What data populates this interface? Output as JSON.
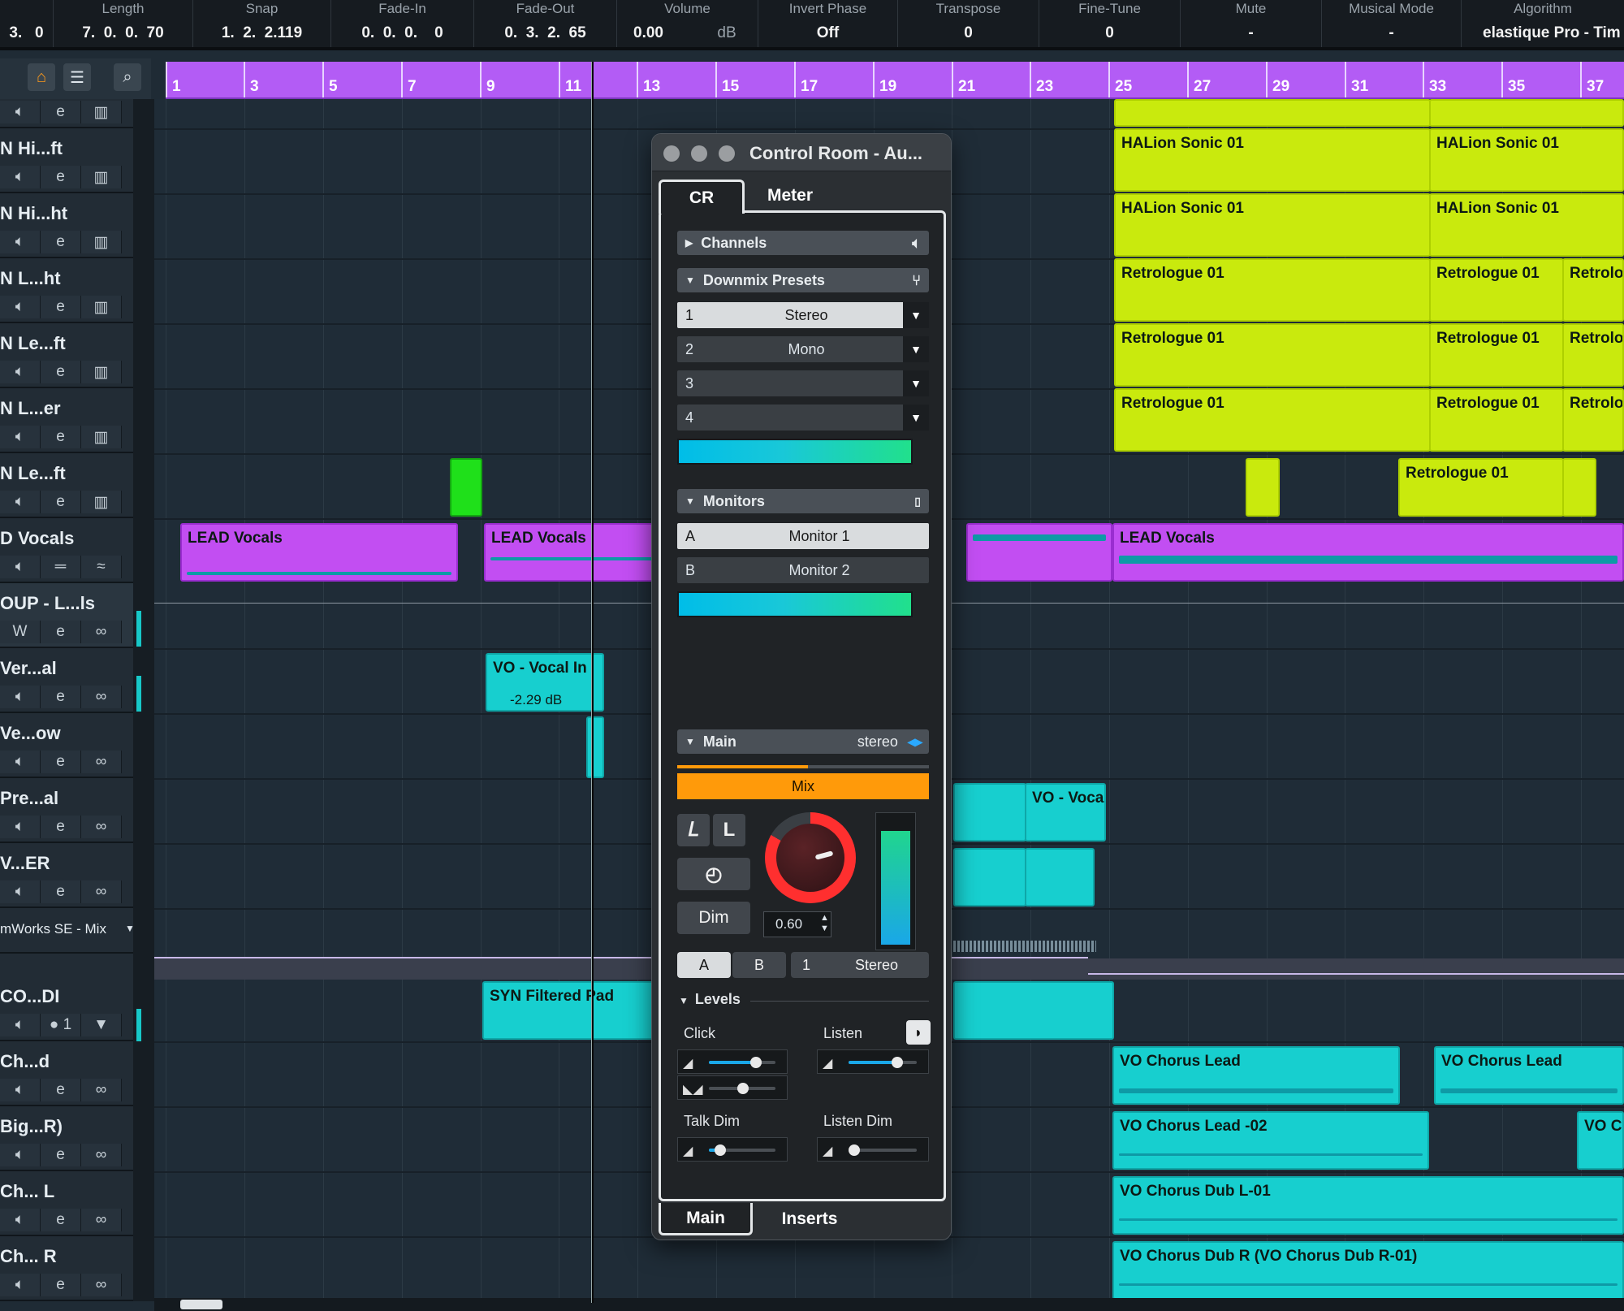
{
  "infoline": [
    {
      "label": "",
      "value": "3.   0"
    },
    {
      "label": "Length",
      "value": "7.  0.  0.  70"
    },
    {
      "label": "Snap",
      "value": "1.  2.  2.119"
    },
    {
      "label": "Fade-In",
      "value": "0.  0.  0.    0"
    },
    {
      "label": "Fade-Out",
      "value": "0.  3.  2.  65"
    },
    {
      "label": "Volume",
      "value": "0.00",
      "unit": "dB"
    },
    {
      "label": "Invert Phase",
      "value": "Off"
    },
    {
      "label": "Transpose",
      "value": "0"
    },
    {
      "label": "Fine-Tune",
      "value": "0"
    },
    {
      "label": "Mute",
      "value": "-"
    },
    {
      "label": "Musical Mode",
      "value": "-"
    },
    {
      "label": "Algorithm",
      "value": "elastique Pro - Tim"
    }
  ],
  "ruler": {
    "bars": [
      "1",
      "3",
      "5",
      "7",
      "9",
      "11",
      "13",
      "15",
      "17",
      "19",
      "21",
      "23",
      "25",
      "27",
      "29",
      "31",
      "33",
      "35",
      "37"
    ]
  },
  "tracks": [
    {
      "name": "N Hi...ft"
    },
    {
      "name": "N Hi...ht"
    },
    {
      "name": "N L...ht"
    },
    {
      "name": "N Le...ft"
    },
    {
      "name": "N L...er"
    },
    {
      "name": "N Le...ft"
    },
    {
      "name": "D Vocals"
    },
    {
      "name": "OUP - L...ls"
    },
    {
      "name": "Ver...al"
    },
    {
      "name": "Ve...ow"
    },
    {
      "name": "Pre...al"
    },
    {
      "name": "V...ER"
    },
    {
      "name": "mWorks SE - Mix"
    },
    {
      "name": "CO...DI"
    },
    {
      "name": "Ch...d"
    },
    {
      "name": "Big...R)"
    },
    {
      "name": "Ch... L"
    },
    {
      "name": "Ch... R"
    }
  ],
  "parts": {
    "halion1": "HALion Sonic 01",
    "halion2": "HALion Sonic 01",
    "halion3": "HALion Sonic 01",
    "halion4": "HALion Sonic 01",
    "retro1": "Retrologue 01",
    "retro2": "Retrologue 01",
    "retro3": "Retrolo",
    "retro4": "Retrologue 01",
    "retro5": "Retrologue 01",
    "retro6": "Retrolo",
    "retro7": "Retrologue 01",
    "retro8": "Retrologue 01",
    "retro9": "Retrolo",
    "retro10": "Retrologue 01",
    "lead1": "LEAD Vocals",
    "lead2": "LEAD Vocals",
    "lead3": "LEAD Vocals",
    "vo_in": "VO - Vocal In",
    "vo_in_gain": "-2.29 dB",
    "vo_voca": "VO - Voca",
    "syn_pad": "SYN Filtered Pad",
    "chorus1": "VO Chorus Lead",
    "chorus2": "VO Chorus Lead",
    "chorus3": "VO Chorus Lead -02",
    "chorus4": "VO Cl",
    "chorus5": "VO Chorus Dub L-01",
    "chorus6": "VO Chorus Dub R (VO Chorus Dub R-01)"
  },
  "control_room": {
    "title": "Control Room - Au...",
    "tabs": [
      "CR",
      "Meter"
    ],
    "channels_label": "Channels",
    "downmix_label": "Downmix Presets",
    "downmix": [
      {
        "num": "1",
        "name": "Stereo"
      },
      {
        "num": "2",
        "name": "Mono"
      },
      {
        "num": "3",
        "name": ""
      },
      {
        "num": "4",
        "name": ""
      }
    ],
    "monitors_label": "Monitors",
    "monitors": [
      {
        "key": "A",
        "name": "Monitor 1"
      },
      {
        "key": "B",
        "name": "Monitor 2"
      }
    ],
    "main_label": "Main",
    "main_format": "stereo",
    "mix_label": "Mix",
    "dim_label": "Dim",
    "dim_value": "0.60",
    "ab": [
      "A",
      "B"
    ],
    "output_num": "1",
    "output_name": "Stereo",
    "levels_label": "Levels",
    "click_label": "Click",
    "listen_label": "Listen",
    "talkdim_label": "Talk Dim",
    "listendim_label": "Listen Dim",
    "click_level": 0.73,
    "click_pan": 0.5,
    "listen_level": 0.73,
    "talkdim_level": 0.1,
    "listendim_level": 0.0,
    "bottom_tabs": [
      "Main",
      "Inserts"
    ]
  },
  "colors": {
    "lime": "#c9ea0d",
    "purple": "#c24ef2",
    "cyan": "#17cfcf",
    "orange": "#ff9a0a",
    "ruler": "#b35cf5"
  }
}
